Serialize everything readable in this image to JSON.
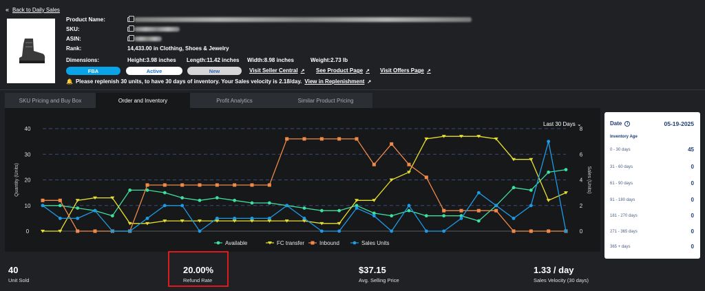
{
  "back": {
    "label": "Back to Daily Sales"
  },
  "product": {
    "name_label": "Product Name:",
    "sku_label": "SKU:",
    "asin_label": "ASIN:",
    "rank_label": "Rank:",
    "rank_value": "14,433.00 in Clothing, Shoes & Jewelry",
    "dimensions_label": "Dimensions:",
    "height": "Height:3.98 inches",
    "length": "Length:11.42 inches",
    "width": "Width:8.98 inches",
    "weight": "Weight:2.73 lb"
  },
  "badges": {
    "fba": "FBA",
    "active": "Active",
    "new": "New"
  },
  "links": {
    "seller_central": "Visit Seller Central",
    "product_page": "See Product Page",
    "offers_page": "Visit Offers Page"
  },
  "warning": {
    "text": "Please replenish 30 units, to have 30 days of inventory. Your Sales velocity is 2.18/day.",
    "link": "View in Replenishment"
  },
  "tabs": [
    "SKU Pricing and Buy Box",
    "Order and Inventory",
    "Profit Analytics",
    "Similar Product Pricing"
  ],
  "range_select": "Last 30 Days",
  "icons": [
    "back-chevron-icon",
    "copy-icon",
    "external-link-icon",
    "bell-icon",
    "info-icon",
    "chevron-down-icon"
  ],
  "colors": {
    "available": "#3ee0a0",
    "fc_transfer": "#e8e030",
    "inbound": "#f08a4b",
    "sales_units": "#1e9be6",
    "highlight": "#e0191d"
  },
  "chart_data": {
    "type": "line",
    "ylabel": "Quantity (Units)",
    "y2label": "Sales (Units)",
    "ylim": [
      0,
      40
    ],
    "y2lim": [
      0,
      8
    ],
    "yticks": [
      "40",
      "30",
      "20",
      "10",
      "0"
    ],
    "y2ticks": [
      "8",
      "6",
      "4",
      "2",
      "0"
    ],
    "grid": true,
    "legend_position": "bottom",
    "series": [
      {
        "name": "Available",
        "axis": "left",
        "values": [
          10,
          10,
          9,
          8,
          6,
          16,
          16,
          15,
          13,
          12,
          13,
          12,
          11,
          11,
          10,
          9,
          8,
          8,
          10,
          7,
          6,
          8,
          6,
          6,
          6,
          4,
          10,
          17,
          16,
          23,
          24
        ]
      },
      {
        "name": "FC transfer",
        "axis": "left",
        "values": [
          0,
          0,
          12,
          13,
          13,
          3,
          3,
          4,
          4,
          4,
          4,
          4,
          4,
          4,
          4,
          4,
          3,
          3,
          12,
          12,
          20,
          23,
          36,
          37,
          37,
          37,
          36,
          28,
          28,
          12,
          15
        ]
      },
      {
        "name": "Inbound",
        "axis": "left",
        "values": [
          12,
          12,
          0,
          0,
          0,
          0,
          18,
          18,
          18,
          18,
          18,
          18,
          18,
          18,
          36,
          36,
          36,
          36,
          36,
          26,
          34,
          26,
          21,
          8,
          8,
          8,
          8,
          0,
          0,
          0,
          0
        ]
      },
      {
        "name": "Sales Units",
        "axis": "right",
        "values": [
          2,
          1,
          1,
          1.6,
          0,
          0,
          1,
          2,
          2,
          0,
          1,
          1,
          1,
          1,
          2,
          1,
          0,
          0,
          1.8,
          1.2,
          0,
          2,
          0,
          0,
          1,
          3,
          2,
          1,
          2,
          7,
          0
        ]
      }
    ]
  },
  "inventory": {
    "date_label": "Date",
    "date": "05-19-2025",
    "age_label": "Inventory Age",
    "rows": [
      {
        "range": "0 - 30 days",
        "value": "45"
      },
      {
        "range": "31 - 60 days",
        "value": "0"
      },
      {
        "range": "61 - 90 days",
        "value": "0"
      },
      {
        "range": "91 - 180 days",
        "value": "0"
      },
      {
        "range": "181 - 270 days",
        "value": "0"
      },
      {
        "range": "271 - 365 days",
        "value": "0"
      },
      {
        "range": "365 + days",
        "value": "0"
      }
    ]
  },
  "stats": [
    {
      "value": "40",
      "label": "Unit Sold"
    },
    {
      "value": "20.00%",
      "label": "Refund Rate"
    },
    {
      "value": "$37.15",
      "label": "Avg. Selling Price"
    },
    {
      "value": "1.33 / day",
      "label": "Sales Velocity (30 days)"
    }
  ]
}
